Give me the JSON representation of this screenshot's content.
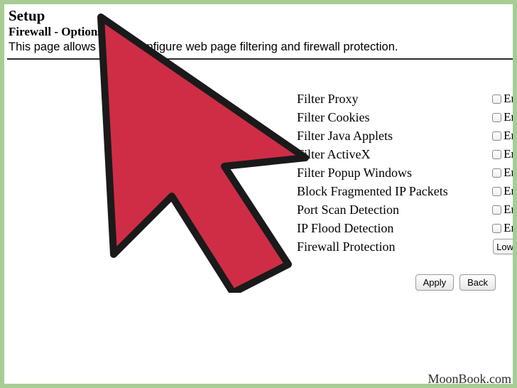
{
  "header": {
    "title": "Setup",
    "subtitle": "Firewall - Options",
    "description": "This page allows you to configure web page filtering and firewall protection."
  },
  "options": [
    {
      "label": "Filter Proxy",
      "control": "checkbox",
      "after": "En"
    },
    {
      "label": "Filter Cookies",
      "control": "checkbox",
      "after": "En"
    },
    {
      "label": "Filter Java Applets",
      "control": "checkbox",
      "after": "En"
    },
    {
      "label": "Filter ActiveX",
      "control": "checkbox",
      "after": "En"
    },
    {
      "label": "Filter Popup Windows",
      "control": "checkbox",
      "after": "En"
    },
    {
      "label": "Block Fragmented IP Packets",
      "control": "checkbox",
      "after": "En"
    },
    {
      "label": "Port Scan Detection",
      "control": "checkbox",
      "after": "En"
    },
    {
      "label": "IP Flood Detection",
      "control": "checkbox",
      "after": "En"
    },
    {
      "label": "Firewall Protection",
      "control": "select",
      "value": "Low"
    }
  ],
  "buttons": {
    "apply": "Apply",
    "back": "Back"
  },
  "attribution": "MoonBook.com",
  "cursor": {
    "name": "large-red-cursor-icon",
    "color": "#cf2d46",
    "stroke": "#1a1a1a"
  }
}
